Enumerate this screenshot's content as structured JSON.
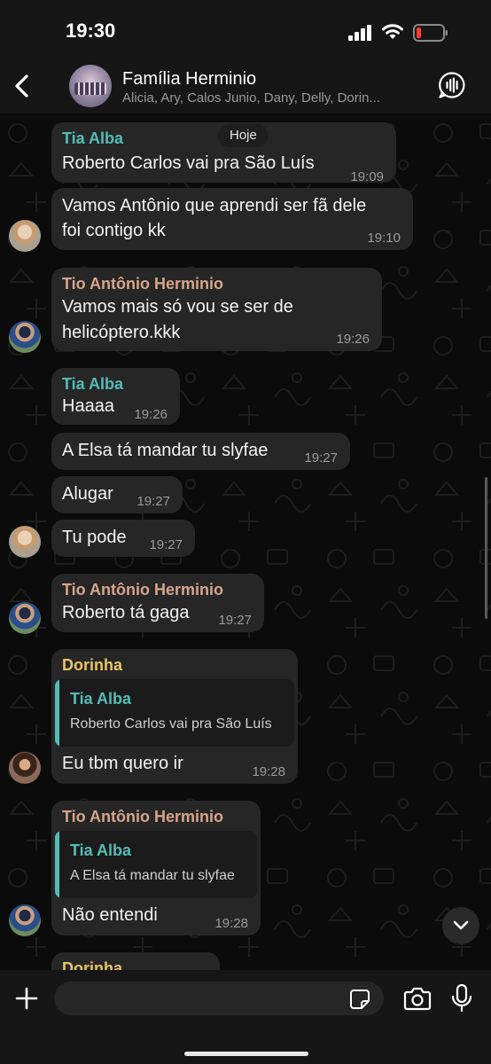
{
  "status_bar": {
    "time": "19:30"
  },
  "header": {
    "back_icon": "chevron-left-icon",
    "group_name": "Família Herminio",
    "members": "Alicia, Ary, Calos Junio, Dany, Delly, Dorin...",
    "call_icon": "audio-waveform-icon"
  },
  "chat": {
    "date_chip": "Hoje",
    "messages": [
      {
        "sender": "Tia Alba",
        "text": "Roberto Carlos vai pra São Luís",
        "time": "19:09"
      },
      {
        "text1": "Vamos Antônio que aprendi ser fã dele",
        "text2": "foi contigo kk",
        "time": "19:10"
      },
      {
        "sender": "Tio Antônio Herminio",
        "text1": "Vamos mais só vou se ser de",
        "text2": "helicóptero.kkk",
        "time": "19:26"
      },
      {
        "sender": "Tia Alba",
        "text": "Haaaa",
        "time": "19:26"
      },
      {
        "text": "A Elsa tá mandar tu slyfae",
        "time": "19:27"
      },
      {
        "text": "Alugar",
        "time": "19:27"
      },
      {
        "text": "Tu pode",
        "time": "19:27"
      },
      {
        "sender": "Tio Antônio Herminio",
        "text": "Roberto tá gaga",
        "time": "19:27"
      },
      {
        "sender": "Dorinha",
        "quote_name": "Tia Alba",
        "quote_text": "Roberto Carlos vai pra São Luís",
        "text": "Eu tbm quero ir",
        "time": "19:28"
      },
      {
        "sender": "Tio Antônio Herminio",
        "quote_name": "Tia Alba",
        "quote_text": "A Elsa tá mandar tu slyfae",
        "text": "Não entendi",
        "time": "19:28"
      },
      {
        "sender": "Dorinha"
      }
    ]
  },
  "input_bar": {
    "placeholder": "",
    "icons": [
      "plus-icon",
      "sticker-icon",
      "camera-icon",
      "microphone-icon"
    ]
  },
  "colors": {
    "background": "#0b0b0b",
    "bubble": "#262626",
    "tia_alba": "#53bdb5",
    "tio_antonio": "#d7a58a",
    "dorinha": "#e8c46a"
  }
}
